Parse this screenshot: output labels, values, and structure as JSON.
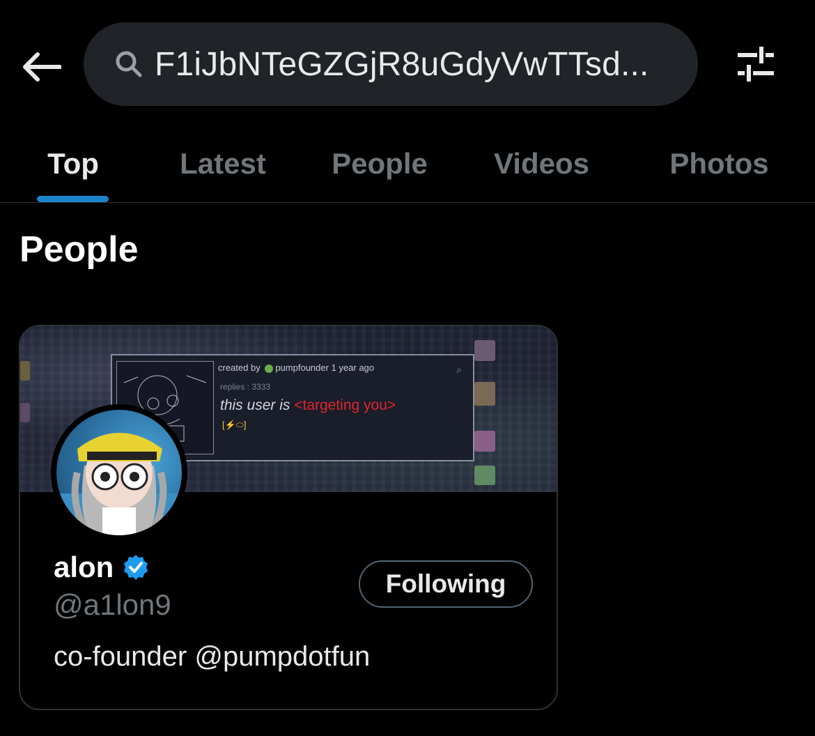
{
  "search": {
    "query": "F1iJbNTeGZGjR8uGdyVwTTsd..."
  },
  "tabs": [
    {
      "label": "Top",
      "active": true
    },
    {
      "label": "Latest",
      "active": false
    },
    {
      "label": "People",
      "active": false
    },
    {
      "label": "Videos",
      "active": false
    },
    {
      "label": "Photos",
      "active": false
    }
  ],
  "section": {
    "title": "People"
  },
  "profile_card": {
    "name": "alon",
    "verified": true,
    "handle": "@a1lon9",
    "bio": "co-founder @pumpdotfun",
    "follow_button": "Following",
    "banner": {
      "meta_prefix": "created by",
      "meta_user": "pumpfounder",
      "meta_time": "1 year ago",
      "replies": "replies : 3333",
      "text_prefix": "this user is",
      "text_highlight": "<targeting you>"
    }
  },
  "icons": {
    "back": "arrow-left-icon",
    "search": "search-icon",
    "filter": "sliders-icon",
    "verified": "verified-badge-icon"
  },
  "colors": {
    "background": "#000000",
    "accent": "#1d9bf0",
    "muted_text": "#71767b",
    "search_bg": "#202327"
  }
}
